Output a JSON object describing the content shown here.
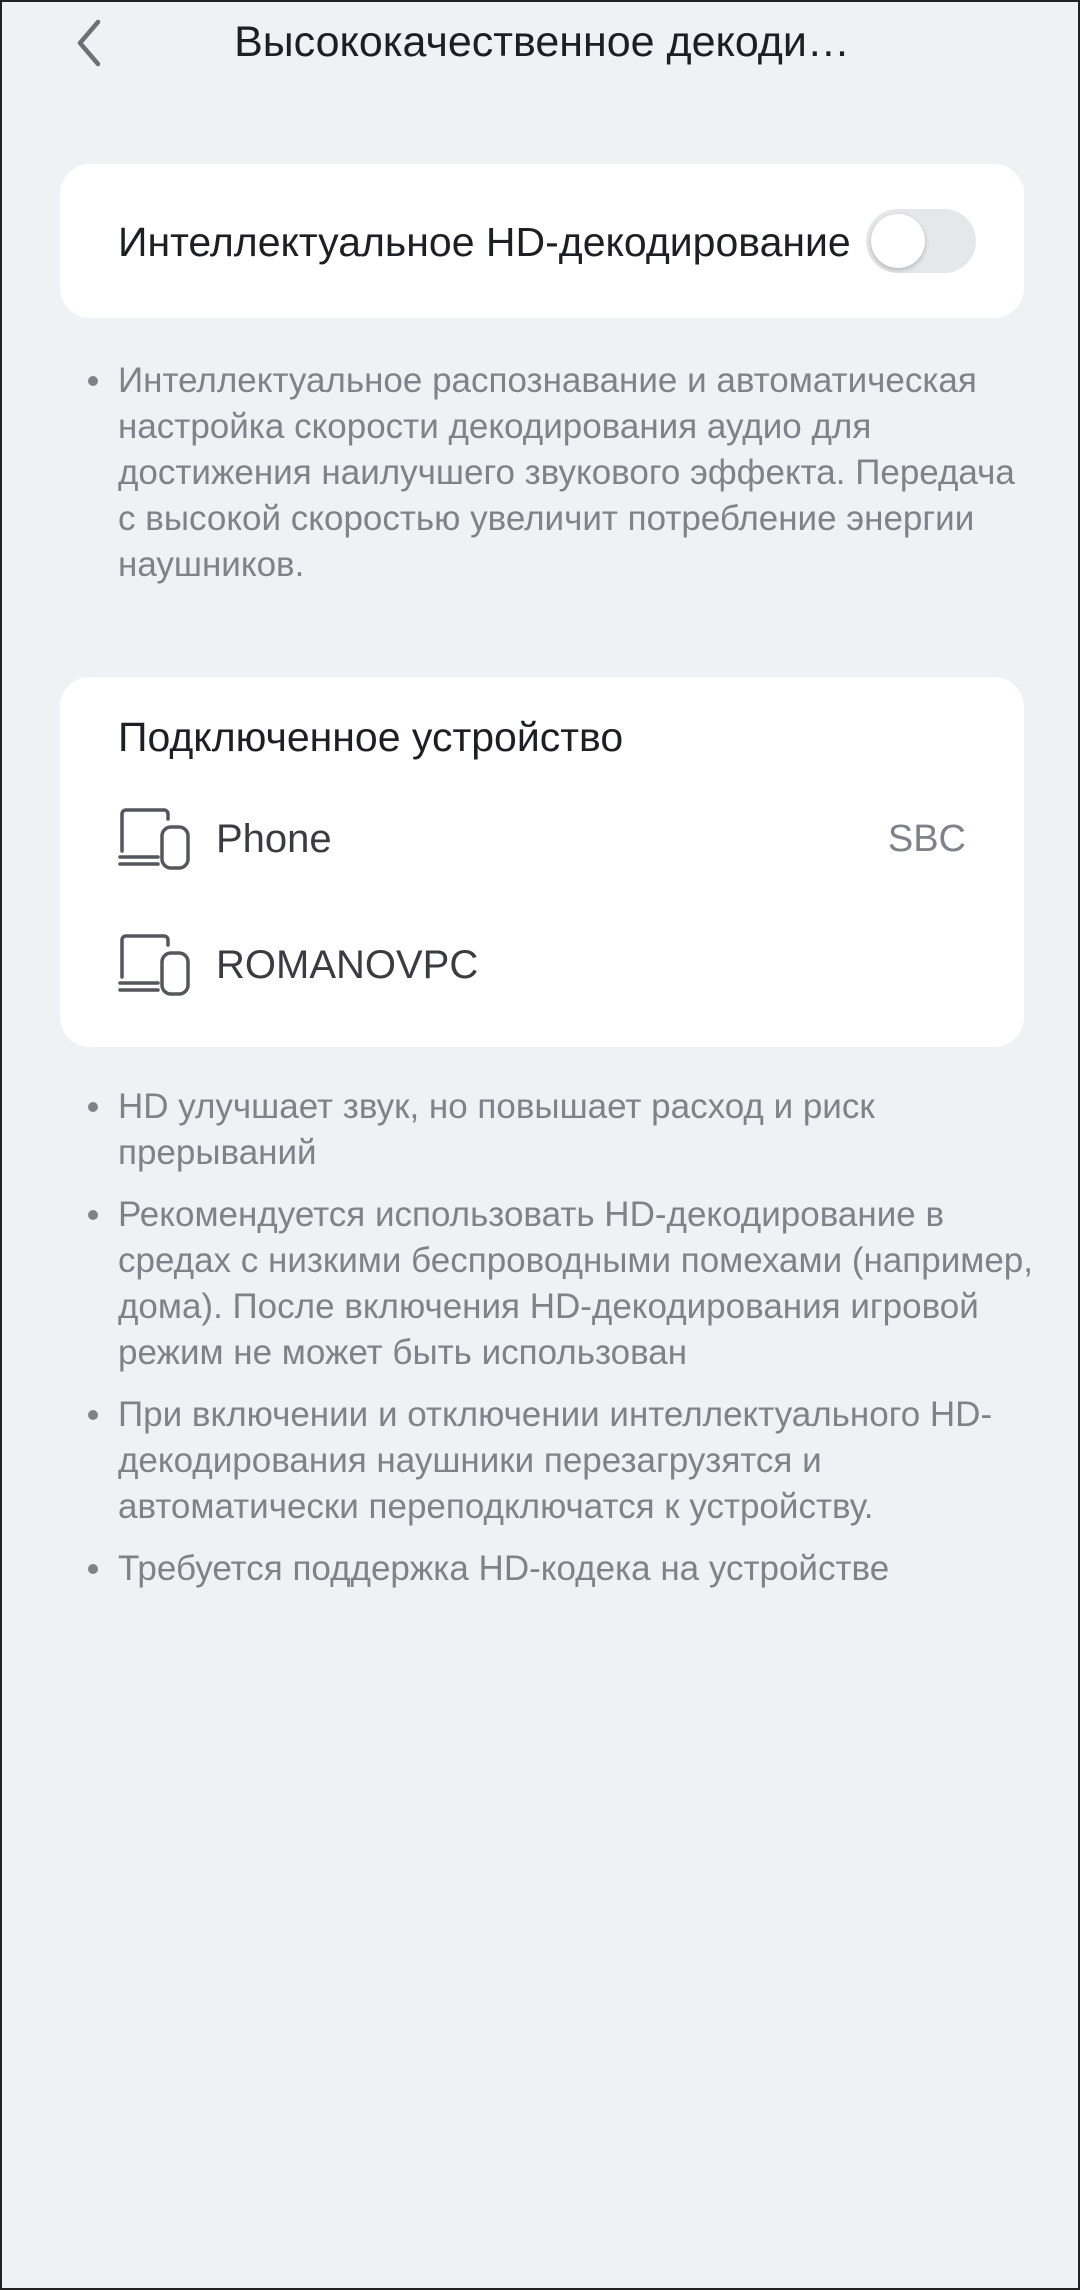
{
  "header": {
    "title": "Высококачественное декоди…",
    "back_icon": "back-arrow-icon"
  },
  "hd_toggle": {
    "label": "Интеллектуальное HD-декодирование",
    "enabled": false
  },
  "description": "Интеллектуальное распознавание и автоматическая настройка скорости декодирования аудио для достижения наилучшего звукового эффекта. Передача с высокой скоростью увеличит потребление энергии наушников.",
  "devices": {
    "title": "Подключенное устройство",
    "items": [
      {
        "name": "Phone",
        "codec": "SBC",
        "icon": "multi-device-icon"
      },
      {
        "name": "ROMANOVPC",
        "codec": "",
        "icon": "multi-device-icon"
      }
    ]
  },
  "notes": [
    "HD улучшает звук, но повышает расход и риск прерываний",
    "Рекомендуется использовать HD-декодирование в средах с низкими беспроводными помехами (например, дома). После включения HD-декодирования игровой режим не может быть использован",
    "При включении и отключении интеллектуального HD-декодирования наушники перезагрузятся и автоматически переподключатся к устройству.",
    "Требуется поддержка HD-кодека на устройстве"
  ],
  "colors": {
    "background": "#f0f1f5",
    "card": "#ffffff",
    "primary_text": "#1d1f24",
    "secondary_text": "#80828a",
    "switch_off": "#e6e7eb"
  }
}
